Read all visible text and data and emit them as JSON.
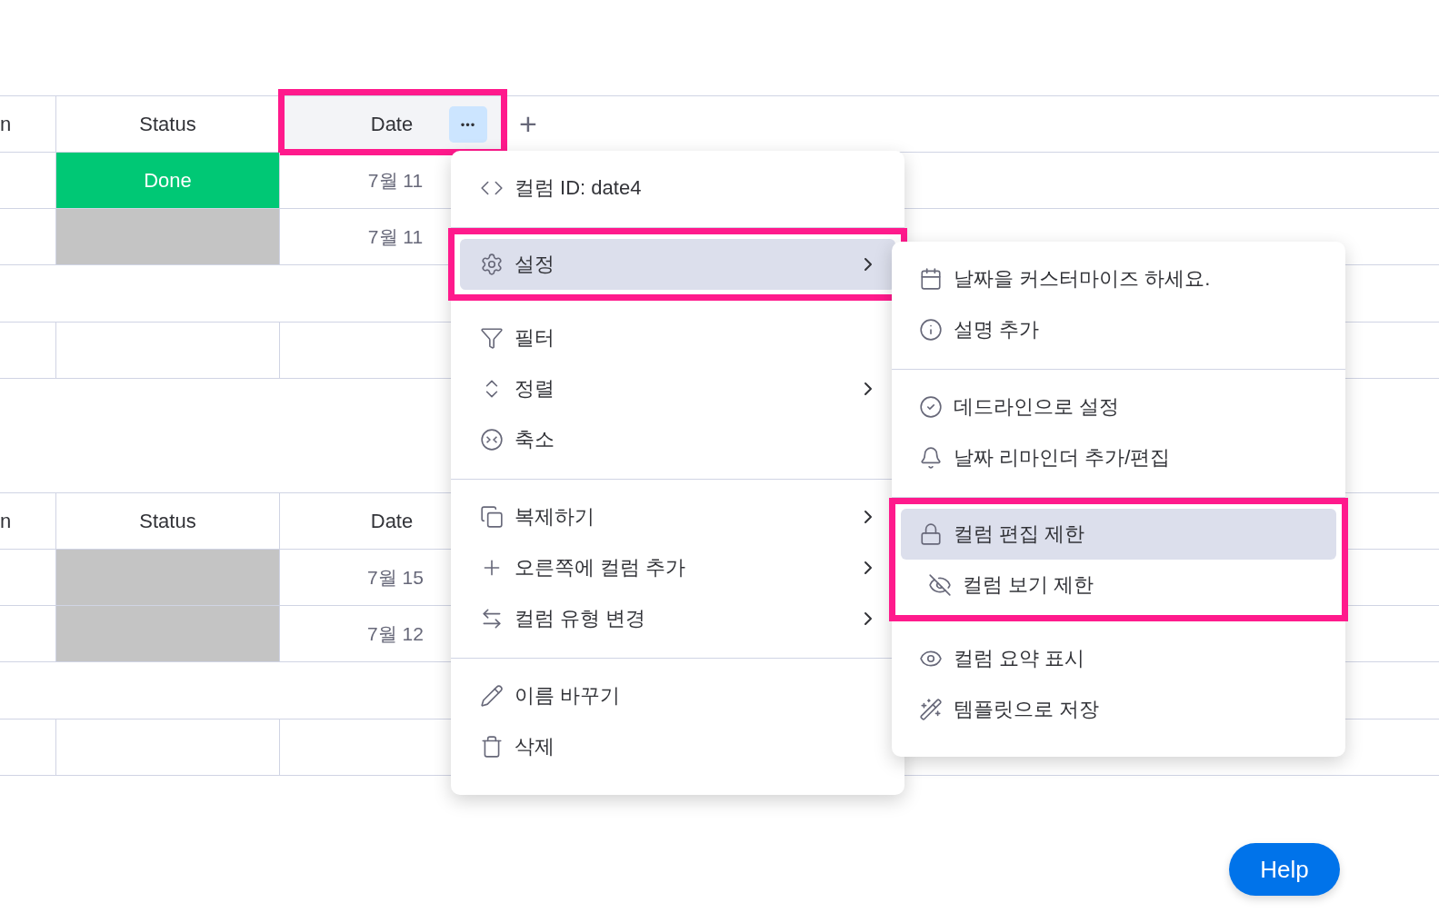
{
  "tables": [
    {
      "columns": [
        {
          "label": "n",
          "active": false
        },
        {
          "label": "Status",
          "active": false
        },
        {
          "label": "Date",
          "active": true,
          "framed": true,
          "more_button": "•••"
        }
      ],
      "add_column": "+",
      "rows": [
        {
          "status": {
            "label": "Done",
            "color": "#00c875"
          },
          "date": "7월 11"
        },
        {
          "status": {
            "color": "#c4c4c4"
          },
          "date": "7월 11"
        }
      ]
    },
    {
      "columns": [
        {
          "label": "n",
          "active": false
        },
        {
          "label": "Status",
          "active": false
        },
        {
          "label": "Date",
          "active": false,
          "framed": false
        }
      ],
      "rows": [
        {
          "status": {
            "color": "#c4c4c4"
          },
          "date": "7월 15"
        },
        {
          "status": {
            "color": "#c4c4c4"
          },
          "date": "7월 12"
        }
      ]
    }
  ],
  "column_menu": {
    "sections": [
      {
        "framed": false,
        "items": [
          {
            "kind": "code",
            "label": "컬럼 ID: date4",
            "submenu": false,
            "selected": false
          }
        ]
      },
      {
        "framed": true,
        "items": [
          {
            "kind": "gear",
            "label": "설정",
            "submenu": true,
            "selected": true
          }
        ]
      },
      {
        "framed": false,
        "items": [
          {
            "kind": "filter",
            "label": "필터",
            "submenu": false,
            "selected": false
          },
          {
            "kind": "sort",
            "label": "정렬",
            "submenu": true,
            "selected": false
          },
          {
            "kind": "collapse",
            "label": "축소",
            "submenu": false,
            "selected": false
          }
        ]
      },
      {
        "framed": false,
        "items": [
          {
            "kind": "copy",
            "label": "복제하기",
            "submenu": true,
            "selected": false
          },
          {
            "kind": "plus",
            "label": "오른쪽에 컬럼 추가",
            "submenu": true,
            "selected": false
          },
          {
            "kind": "swap",
            "label": "컬럼 유형 변경",
            "submenu": true,
            "selected": false
          }
        ]
      },
      {
        "framed": false,
        "items": [
          {
            "kind": "pencil",
            "label": "이름 바꾸기",
            "submenu": false,
            "selected": false
          },
          {
            "kind": "trash",
            "label": "삭제",
            "submenu": false,
            "selected": false
          }
        ]
      }
    ]
  },
  "settings_submenu": {
    "sections": [
      {
        "framed": false,
        "items": [
          {
            "kind": "calendar",
            "label": "날짜을 커스터마이즈 하세요.",
            "submenu": false,
            "selected": false
          },
          {
            "kind": "info",
            "label": "설명 추가",
            "submenu": false,
            "selected": false
          }
        ]
      },
      {
        "framed": false,
        "items": [
          {
            "kind": "check",
            "label": "데드라인으로 설정",
            "submenu": false,
            "selected": false
          },
          {
            "kind": "bell",
            "label": "날짜 리마인더 추가/편집",
            "submenu": false,
            "selected": false
          }
        ]
      },
      {
        "framed": true,
        "items": [
          {
            "kind": "lock",
            "label": "컬럼 편집 제한",
            "submenu": false,
            "selected": true
          },
          {
            "kind": "eye-off",
            "label": "컬럼 보기 제한",
            "submenu": false,
            "selected": false
          }
        ]
      },
      {
        "framed": false,
        "items": [
          {
            "kind": "eye",
            "label": "컬럼 요약 표시",
            "submenu": false,
            "selected": false
          },
          {
            "kind": "wand",
            "label": "템플릿으로 저장",
            "submenu": false,
            "selected": false
          }
        ]
      }
    ]
  },
  "help_button": "Help"
}
